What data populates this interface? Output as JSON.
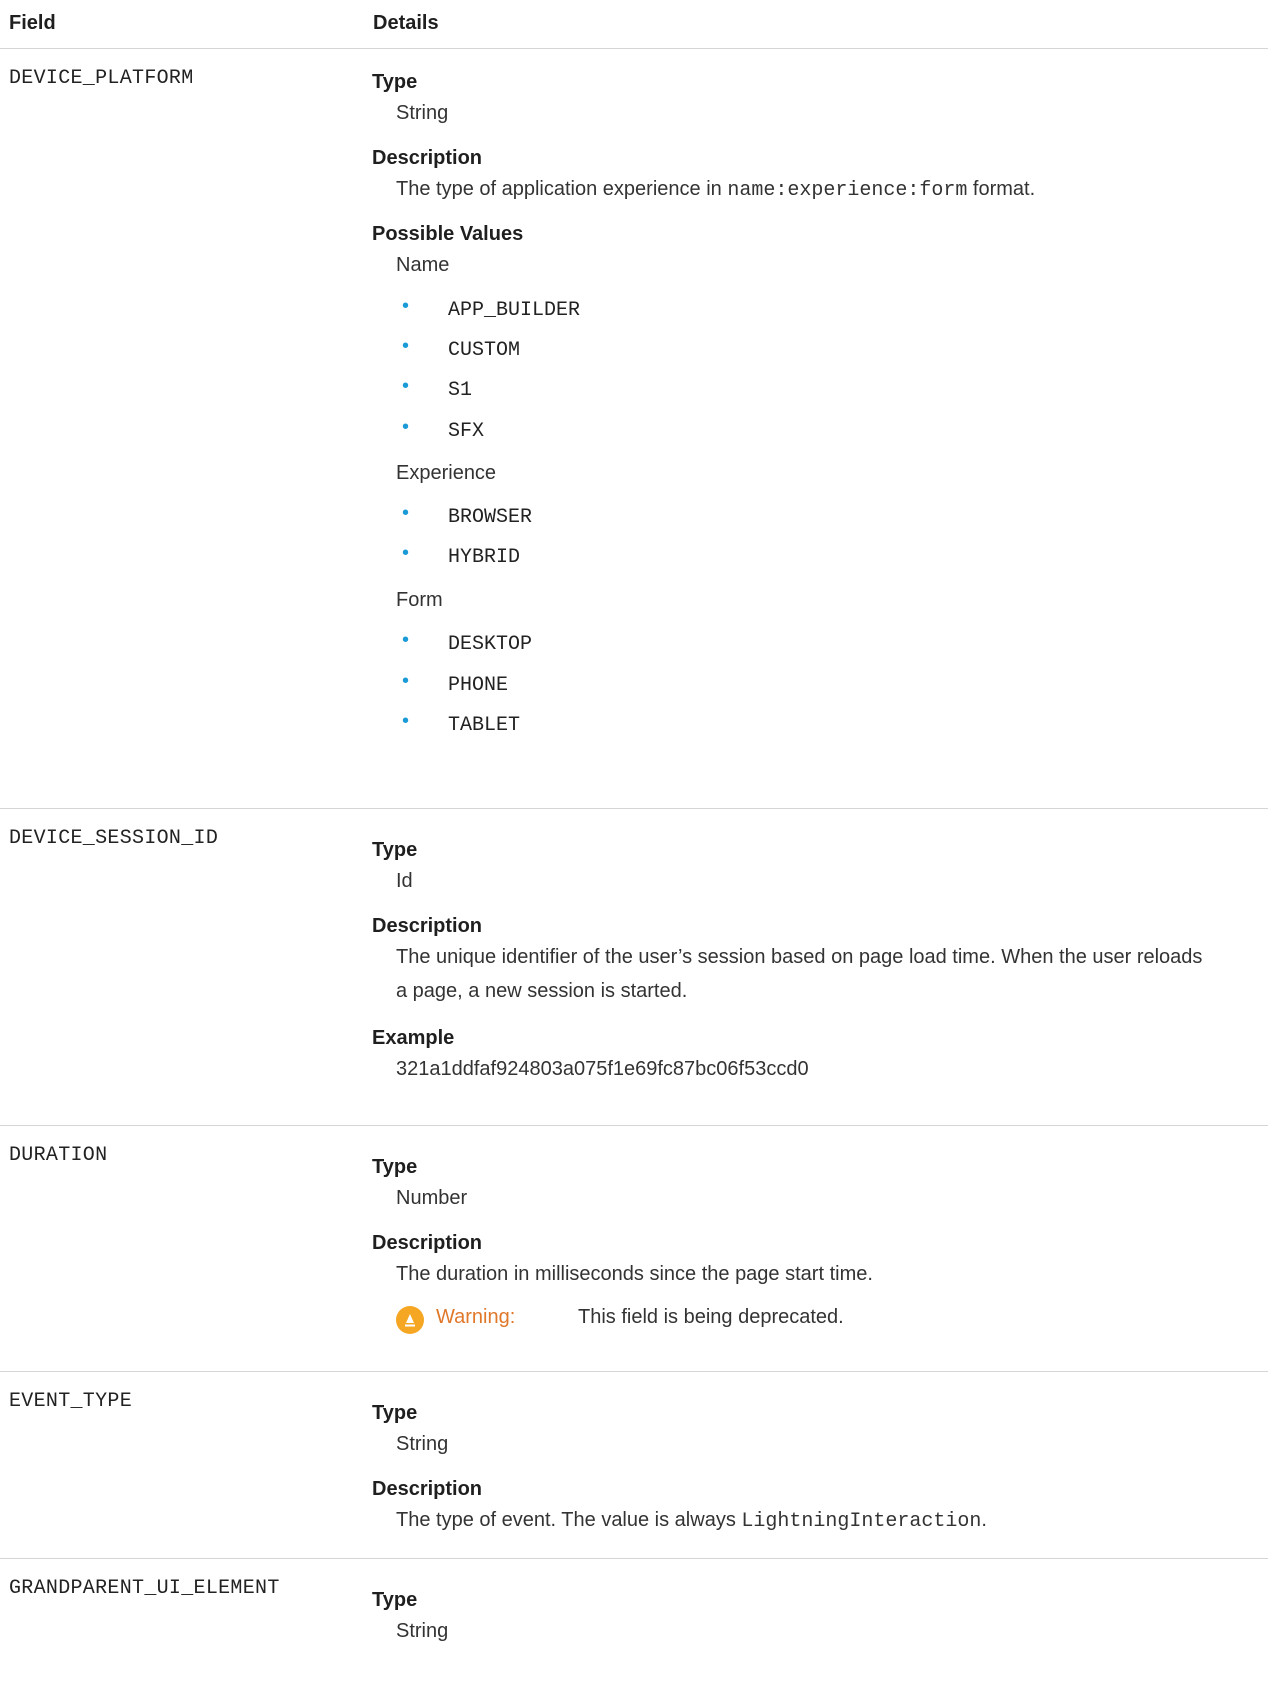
{
  "header": {
    "field": "Field",
    "details": "Details"
  },
  "rows": [
    {
      "field": "DEVICE_PLATFORM",
      "type_label": "Type",
      "type_value": "String",
      "desc_label": "Description",
      "desc_pre": "The type of application experience in ",
      "desc_code": "name:experience:form",
      "desc_post": " format.",
      "pv_label": "Possible Values",
      "groups": [
        {
          "title": "Name",
          "items": [
            "APP_BUILDER",
            "CUSTOM",
            "S1",
            "SFX"
          ]
        },
        {
          "title": "Experience",
          "items": [
            "BROWSER",
            "HYBRID"
          ]
        },
        {
          "title": "Form",
          "items": [
            "DESKTOP",
            "PHONE",
            "TABLET"
          ]
        }
      ]
    },
    {
      "field": "DEVICE_SESSION_ID",
      "type_label": "Type",
      "type_value": "Id",
      "desc_label": "Description",
      "desc_line1": "The unique identifier of the user’s session based on page load time. When the user reloads",
      "desc_line2": "a page, a new session is started.",
      "example_label": "Example",
      "example_value": "321a1ddfaf924803a075f1e69fc87bc06f53ccd0"
    },
    {
      "field": "DURATION",
      "type_label": "Type",
      "type_value": "Number",
      "desc_label": "Description",
      "desc_text": "The duration in milliseconds since the page start time.",
      "warning_label": "Warning:",
      "warning_text": "This field is being deprecated."
    },
    {
      "field": "EVENT_TYPE",
      "type_label": "Type",
      "type_value": "String",
      "desc_label": "Description",
      "desc_pre": "The type of event. The value is always ",
      "desc_code": "LightningInteraction",
      "desc_post": "."
    },
    {
      "field": "GRANDPARENT_UI_ELEMENT",
      "type_label": "Type",
      "type_value": "String"
    }
  ],
  "colors": {
    "bullet": "#1a9bd7",
    "warning_label": "#e0782a",
    "warning_icon": "#f5a623",
    "divider": "#d5d5d5"
  },
  "icons": {
    "warning": "warning-icon",
    "bullet": "bullet-icon"
  }
}
